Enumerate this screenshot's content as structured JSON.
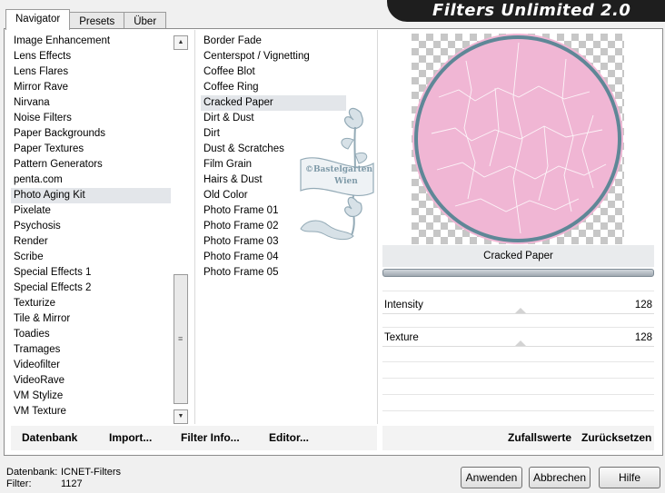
{
  "tabs": [
    "Navigator",
    "Presets",
    "Über"
  ],
  "banner_title": "Filters Unlimited 2.0",
  "categories": [
    "Image Enhancement",
    "Lens Effects",
    "Lens Flares",
    "Mirror Rave",
    "Nirvana",
    "Noise Filters",
    "Paper Backgrounds",
    "Paper Textures",
    "Pattern Generators",
    "penta.com",
    "Photo Aging Kit",
    "Pixelate",
    "Psychosis",
    "Render",
    "Scribe",
    "Special Effects 1",
    "Special Effects 2",
    "Texturize",
    "Tile & Mirror",
    "Toadies",
    "Tramages",
    "Videofilter",
    "VideoRave",
    "VM Stylize",
    "VM Texture"
  ],
  "selected_category": "Photo Aging Kit",
  "filters": [
    "Border Fade",
    "Centerspot / Vignetting",
    "Coffee Blot",
    "Coffee Ring",
    "Cracked Paper",
    "Dirt & Dust",
    "Dirt",
    "Dust & Scratches",
    "Film Grain",
    "Hairs & Dust",
    "Old Color",
    "Photo Frame 01",
    "Photo Frame 02",
    "Photo Frame 03",
    "Photo Frame 04",
    "Photo Frame 05"
  ],
  "selected_filter": "Cracked Paper",
  "watermark": {
    "line1": "©Bastelgarten",
    "line2": "Wien"
  },
  "panel_title": "Cracked Paper",
  "params": [
    {
      "label": "Intensity",
      "value": "128"
    },
    {
      "label": "Texture",
      "value": "128"
    }
  ],
  "bottom_buttons": {
    "datenbank": "Datenbank",
    "import": "Import...",
    "filter_info": "Filter Info...",
    "editor": "Editor...",
    "zufallswerte": "Zufallswerte",
    "zuruecksetzen": "Zurücksetzen"
  },
  "status": {
    "datenbank_label": "Datenbank:",
    "datenbank_value": "ICNET-Filters",
    "filter_label": "Filter:",
    "filter_value": "1127"
  },
  "dialog_buttons": {
    "apply": "Anwenden",
    "cancel": "Abbrechen",
    "help": "Hilfe"
  },
  "colors": {
    "preview_fill": "#f0b6d4",
    "preview_ring": "#5f8797",
    "banner_bg": "#1e1e1e"
  }
}
